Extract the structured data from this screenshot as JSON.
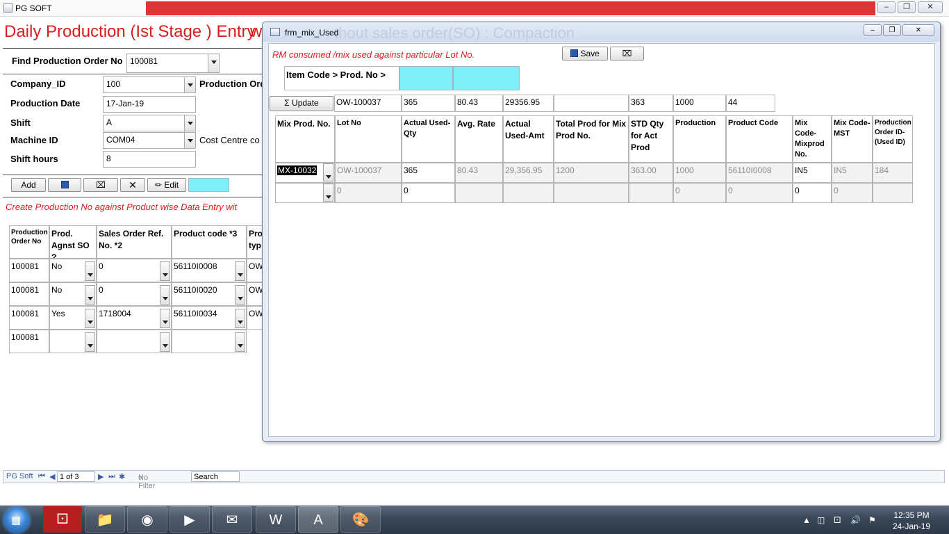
{
  "app": {
    "title": "PG SOFT"
  },
  "main": {
    "title": "Daily Production (Ist Stage ) Entry",
    "title_suffix": "w",
    "find": {
      "label": "Find Production Order No",
      "value": "100081"
    },
    "fields": [
      {
        "label": "Company_ID",
        "value": "100"
      },
      {
        "label": "Production Date",
        "value": "17-Jan-19"
      },
      {
        "label": "Shift",
        "value": "A"
      },
      {
        "label": "Machine ID",
        "value": "COM04"
      },
      {
        "label": "Shift hours",
        "value": "8"
      }
    ],
    "production_order_label": "Production Ord",
    "cost_centre_label": "Cost Centre co",
    "buttons": {
      "add": "Add",
      "edit": "Edit"
    },
    "create_note": "Create Production No against Product wise Data Entry wit",
    "grid": {
      "headers": [
        "Production Order No",
        "Prod. Agnst SO ?",
        "Sales Order Ref. No. *2",
        "Product code *3",
        "Pro typ"
      ],
      "rows": [
        [
          "100081",
          "No",
          "0",
          "56110I0008",
          "OW"
        ],
        [
          "100081",
          "No",
          "0",
          "56110I0020",
          "OW"
        ],
        [
          "100081",
          "Yes",
          "1718004",
          "56110I0034",
          "OW"
        ],
        [
          "100081",
          "",
          "",
          "",
          ""
        ]
      ]
    }
  },
  "nav": {
    "label": "PG Soft",
    "record": "1 of 3",
    "filter": "No Filter",
    "search": "Search"
  },
  "popup": {
    "title": "frm_mix_Used",
    "ghost_title": "thout sales order(SO) : Compaction",
    "note": "RM consumed /mix used  against particular Lot  No.",
    "save_label": "Save",
    "item_code_label": "Item Code  > Prod. No >",
    "update_label": "Update",
    "summary": [
      "OW-100037",
      "365",
      "80.43",
      "29356.95",
      "",
      "363",
      "1000",
      "44"
    ],
    "headers": [
      "Mix Prod. No.",
      "Lot No",
      "Actual Used-Qty",
      "Avg. Rate",
      "Actual Used-Amt",
      "Total Prod for Mix Prod No.",
      "STD Qty for Act Prod",
      "Production",
      "Product Code",
      "Mix Code-Mixprod No.",
      "Mix Code-MST",
      "Production Order ID-(Used ID)"
    ],
    "rows": [
      [
        "MX-10032",
        "OW-100037",
        "365",
        "80.43",
        "29,356.95",
        "1200",
        "363.00",
        "1000",
        "56110I0008",
        "IN5",
        "IN5",
        "184"
      ],
      [
        "",
        "0",
        "0",
        "",
        "",
        "",
        "",
        "0",
        "0",
        "0",
        "0",
        ""
      ]
    ]
  },
  "taskbar": {
    "time": "12:35 PM",
    "date": "24-Jan-19"
  }
}
